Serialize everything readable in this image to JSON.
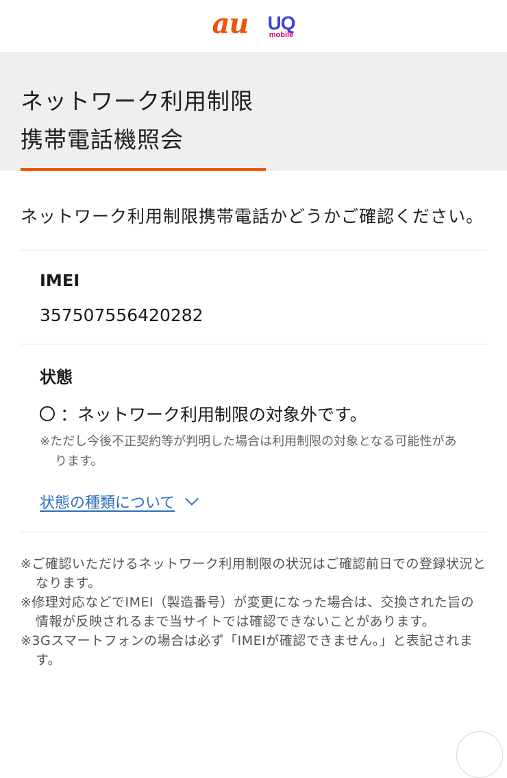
{
  "header": {
    "logo_au": "au",
    "logo_uq": "UQ",
    "logo_mobile": "mobile"
  },
  "title": {
    "line1": "ネットワーク利用制限",
    "line2": "携帯電話機照会"
  },
  "intro": "ネットワーク利用制限携帯電話かどうかご確認ください。",
  "imei": {
    "label": "IMEI",
    "value": "357507556420282"
  },
  "status": {
    "label": "状態",
    "symbol": "○",
    "text": "：ネットワーク利用制限の対象外です。",
    "note": "※ただし今後不正契約等が判明した場合は利用制限の対象となる可能性があります。",
    "link_label": "状態の種類について"
  },
  "footer_notes": [
    "※ご確認いただけるネットワーク利用制限の状況はご確認前日での登録状況となります。",
    "※修理対応などでIMEI（製造番号）が変更になった場合は、交換された旨の情報が反映されるまで当サイトでは確認できないことがあります。",
    "※3Gスマートフォンの場合は必ず「IMEIが確認できません。」と表記されます。"
  ],
  "colors": {
    "au_orange": "#eb5505",
    "uq_blue": "#3a47c8",
    "uq_pink": "#e6007e",
    "link_blue": "#2a6fbf"
  }
}
